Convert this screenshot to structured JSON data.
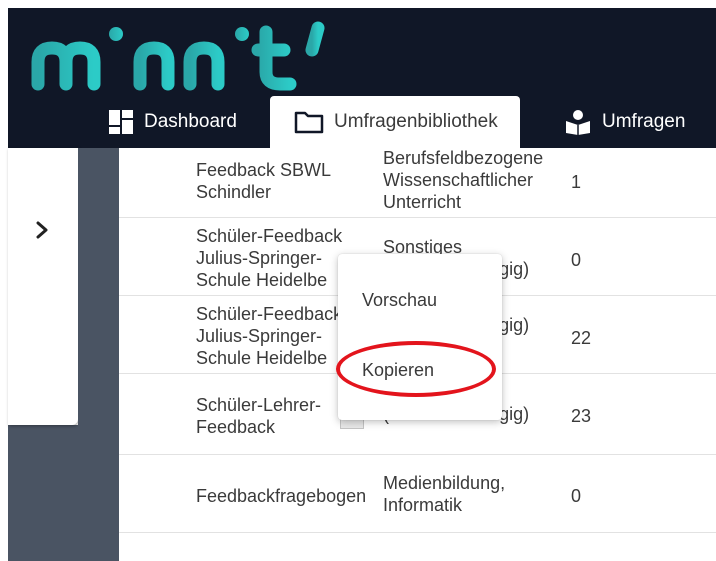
{
  "app": {
    "logo_text": "minnit'"
  },
  "nav": {
    "tabs": [
      {
        "label": "Dashboard",
        "icon": "dashboard-icon",
        "active": false
      },
      {
        "label": "Umfragenbibliothek",
        "icon": "folder-icon",
        "active": true
      },
      {
        "label": "Umfragen",
        "icon": "reader-icon",
        "active": false
      }
    ]
  },
  "sidebar": {
    "toggle_icon": "chevron-right-icon"
  },
  "table": {
    "rows": [
      {
        "name": [
          "Feedback SBWL",
          "Schindler"
        ],
        "category": [
          "Berufsfeldbezogene",
          "Wissenschaftlicher",
          "Unterricht"
        ],
        "count": "1"
      },
      {
        "name": [
          "Schüler-Feedback",
          "Julius-Springer-",
          "Schule Heidelbe"
        ],
        "category": [
          "Sonstiges",
          "(Fachunabhängig)"
        ],
        "count": "0"
      },
      {
        "name": [
          "Schüler-Feedback",
          "Julius-Springer-",
          "Schule Heidelbe"
        ],
        "category": [
          "",
          "(Fachunabhängig)"
        ],
        "count": "22"
      },
      {
        "name": [
          "Schüler-Lehrer-",
          "Feedback"
        ],
        "category": [
          "",
          "(Fachunabhängig)"
        ],
        "count": "23"
      },
      {
        "name": [
          "Feedbackfragebogen"
        ],
        "category": [
          "Medienbildung,",
          "Informatik"
        ],
        "count": "0"
      }
    ]
  },
  "context_menu": {
    "items": [
      {
        "label": "Vorschau"
      },
      {
        "label": "Kopieren",
        "highlighted": true
      }
    ]
  },
  "colors": {
    "header_bg": "#101727",
    "sidebar_dark": "#4a5463",
    "logo_gradient_start": "#2aa7a8",
    "logo_gradient_end": "#2ccbc7",
    "highlight_ring": "#e3141c"
  }
}
